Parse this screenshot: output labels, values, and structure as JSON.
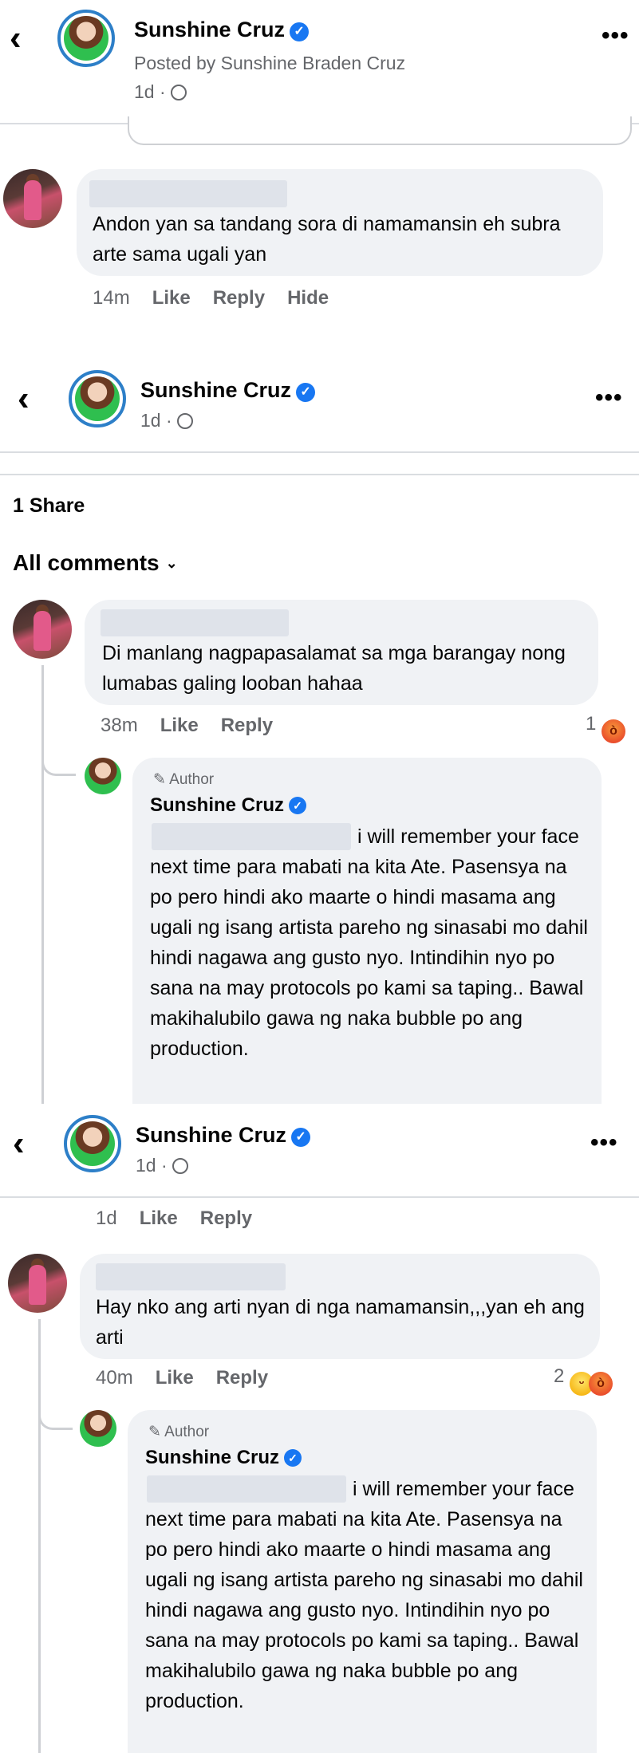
{
  "post": {
    "page_name": "Sunshine Cruz",
    "posted_by": "Posted by Sunshine Braden Cruz",
    "time": "1d ·"
  },
  "labels": {
    "like": "Like",
    "reply": "Reply",
    "hide": "Hide",
    "author": "Author",
    "share_count": "1 Share",
    "all_comments": "All comments"
  },
  "comments": [
    {
      "text": "Andon yan sa tandang sora di namamansin eh subra arte sama ugali yan",
      "time": "14m"
    },
    {
      "text": "Di manlang nagpapasalamat sa mga barangay nong lumabas galing looban hahaa",
      "time": "38m",
      "reaction_count": "1",
      "reactions": [
        "angry"
      ]
    },
    {
      "text": "Hay nko ang arti nyan di nga namamansin,,,yan eh ang arti",
      "time": "40m",
      "reaction_count": "2",
      "reactions": [
        "haha",
        "angry"
      ]
    }
  ],
  "author_reply": {
    "name": "Sunshine Cruz",
    "text": "i will remember your face next time para mabati na kita Ate. Pasensya na po pero hindi ako maarte o hindi masama ang ugali ng isang artista pareho ng sinasabi mo dahil hindi nagawa ang gusto nyo. Intindihin nyo po sana na may protocols po kami sa taping.. Bawal makihalubilo gawa ng naka bubble po ang production.",
    "previous_reply_time": "1d"
  },
  "colors": {
    "verified": "#1877f2",
    "secondary_text": "#65676b",
    "bubble": "#f0f2f5",
    "ring": "#2d7fc8"
  }
}
